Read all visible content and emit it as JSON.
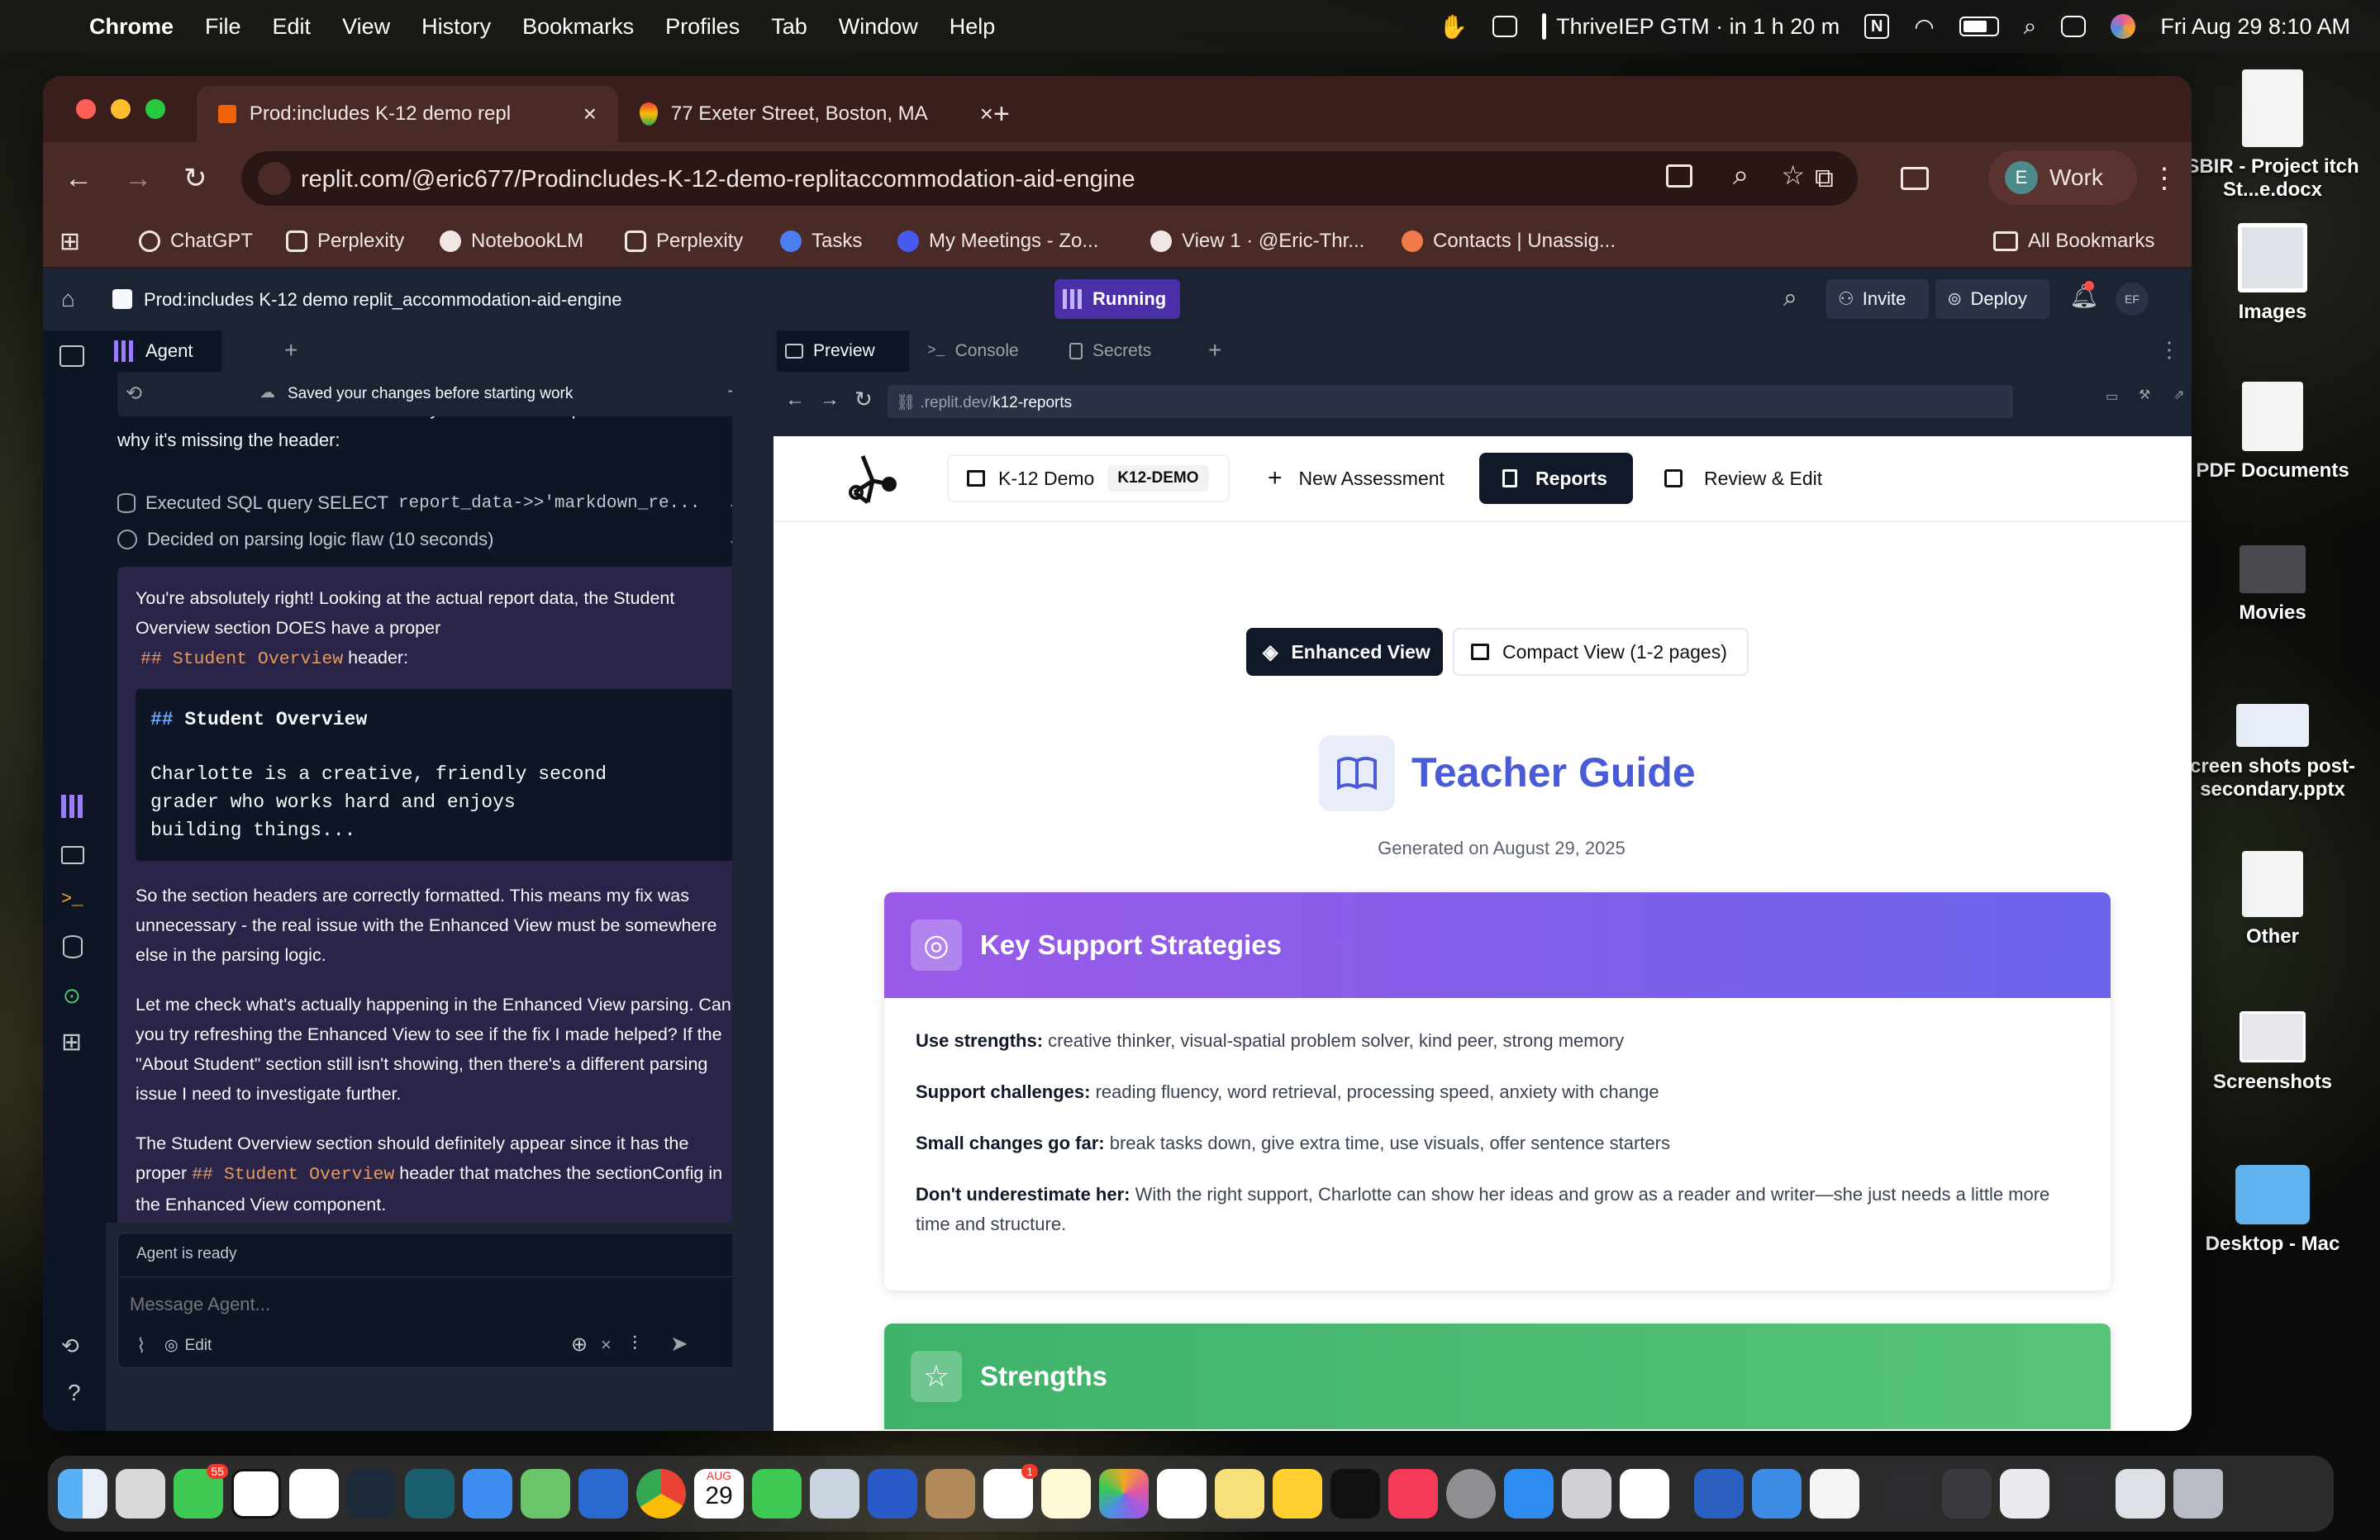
{
  "menubar": {
    "app": "Chrome",
    "items": [
      "File",
      "Edit",
      "View",
      "History",
      "Bookmarks",
      "Profiles",
      "Tab",
      "Window",
      "Help"
    ],
    "event": "ThriveIEP GTM · in 1 h 20 m",
    "datetime": "Fri Aug 29  8:10 AM"
  },
  "browser": {
    "tabs": [
      {
        "label": "Prod:includes K-12 demo repl",
        "icon": "replit-icon",
        "active": true
      },
      {
        "label": "77 Exeter Street, Boston, MA",
        "icon": "google-maps-icon",
        "active": false
      }
    ],
    "url": "replit.com/@eric677/Prodincludes-K-12-demo-replitaccommodation-aid-engine",
    "profile": {
      "initial": "E",
      "label": "Work"
    },
    "bookmarks": [
      "ChatGPT",
      "Perplexity",
      "NotebookLM",
      "Perplexity",
      "Tasks",
      "My Meetings - Zo...",
      "View 1 · @Eric-Thr...",
      "Contacts | Unassig..."
    ],
    "all_bookmarks": "All Bookmarks"
  },
  "replit": {
    "project_title": "Prod:includes K-12 demo replit_accommodation-aid-engine",
    "status": "Running",
    "invite": "Invite",
    "deploy": "Deploy",
    "avatar": "EF",
    "agent_tab": "Agent",
    "saved_notice": "Saved your changes before starting work",
    "prev_line1": "## header. Let me check what's actually in the current report to see",
    "prev_line2": "why it's missing the header:",
    "sql_action": "Executed SQL query SELECT report_data->>'markdown_re...",
    "sql_prefix": "Executed SQL query SELECT",
    "sql_code": "report_data->>'markdown_re...",
    "decided": "Decided on parsing logic flaw (10 seconds)",
    "msg1_a": "You're absolutely right! Looking at the actual report data, the Student Overview section DOES have a proper",
    "msg1_code": "## Student Overview",
    "msg1_b": "header:",
    "code_heading_hash": "##",
    "code_heading": "Student Overview",
    "code_body": "Charlotte is a creative, friendly second grader who works hard and enjoys building things...",
    "msg2": "So the section headers are correctly formatted. This means my fix was unnecessary - the real issue with the Enhanced View must be somewhere else in the parsing logic.",
    "msg3": "Let me check what's actually happening in the Enhanced View parsing. Can you try refreshing the Enhanced View to see if the fix I made helped? If the \"About Student\" section still isn't showing, then there's a different parsing issue I need to investigate further.",
    "msg4_a": "The Student Overview section should definitely appear since it has the proper",
    "msg4_code": "## Student Overview",
    "msg4_b": "header that matches the sectionConfig in the Enhanced View component.",
    "agent_ready": "Agent is ready",
    "message_placeholder": "Message Agent...",
    "edit_label": "Edit",
    "pane_tabs": [
      "Preview",
      "Console",
      "Secrets"
    ],
    "preview_url_prefix": ".replit.dev/",
    "preview_url_path": "k12-reports"
  },
  "app": {
    "demo_label": "K-12 Demo",
    "demo_badge": "K12-DEMO",
    "nav": [
      "New Assessment",
      "Reports",
      "Review & Edit"
    ],
    "view_buttons": [
      "Enhanced View",
      "Compact View (1-2 pages)"
    ],
    "title": "Teacher Guide",
    "generated": "Generated on August 29, 2025",
    "strategies_title": "Key Support Strategies",
    "strategies": [
      {
        "label": "Use strengths:",
        "text": "creative thinker, visual-spatial problem solver, kind peer, strong memory"
      },
      {
        "label": "Support challenges:",
        "text": "reading fluency, word retrieval, processing speed, anxiety with change"
      },
      {
        "label": "Small changes go far:",
        "text": "break tasks down, give extra time, use visuals, offer sentence starters"
      },
      {
        "label": "Don't underestimate her:",
        "text": "With the right support, Charlotte can show her ideas and grow as a reader and writer—she just needs a little more time and structure."
      }
    ],
    "strengths_title": "Strengths"
  },
  "desktop": [
    "SBIR - Project itch St...e.docx",
    "Images",
    "PDF Documents",
    "Movies",
    "creen shots post-secondary.pptx",
    "Other",
    "Screenshots",
    "Desktop - Mac"
  ],
  "dock_badges": {
    "messages": "55",
    "calendar_month": "AUG",
    "calendar_day": "29",
    "reminders": "1"
  }
}
